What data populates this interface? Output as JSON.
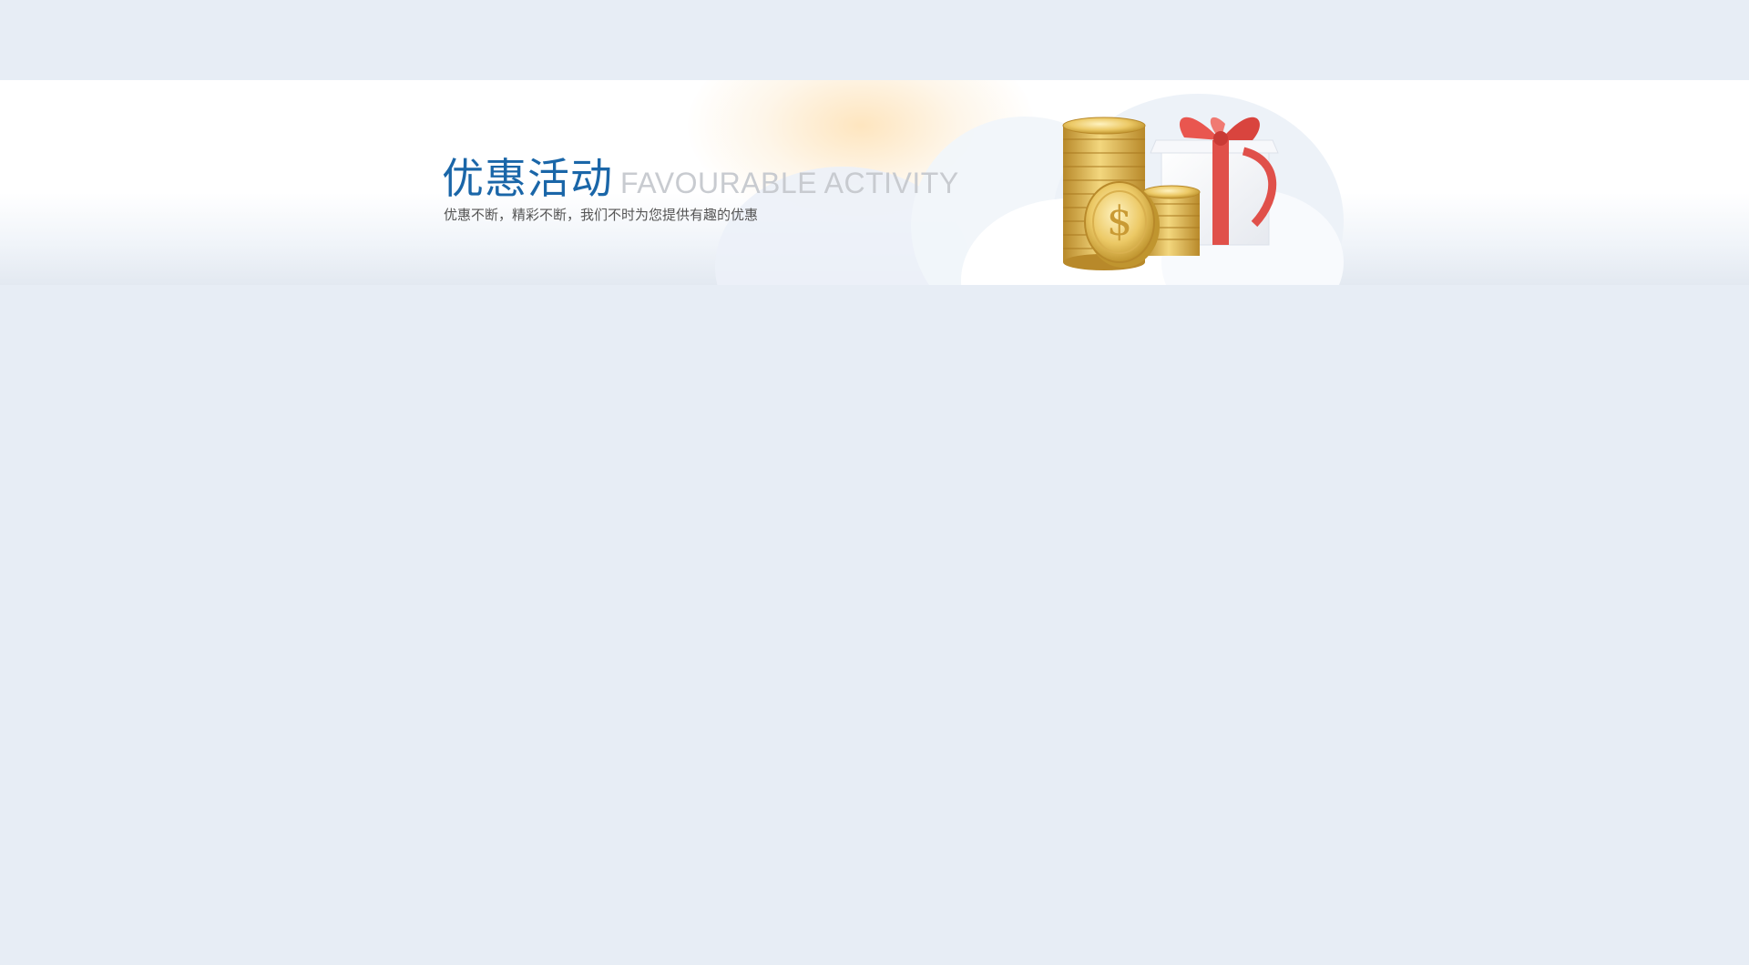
{
  "banner": {
    "title_cn": "优惠活动",
    "title_en": "FAVOURABLE ACTIVITY",
    "subtitle": "优惠不断，精彩不断，我们不时为您提供有趣的优惠",
    "illustration_icon": "coins-and-gift-icon",
    "colors": {
      "title": "#1a66a8",
      "title_en": "#c8cbd0",
      "background": "#e7edf5",
      "ribbon": "#e0504a",
      "coin": "#e2b94f"
    }
  }
}
